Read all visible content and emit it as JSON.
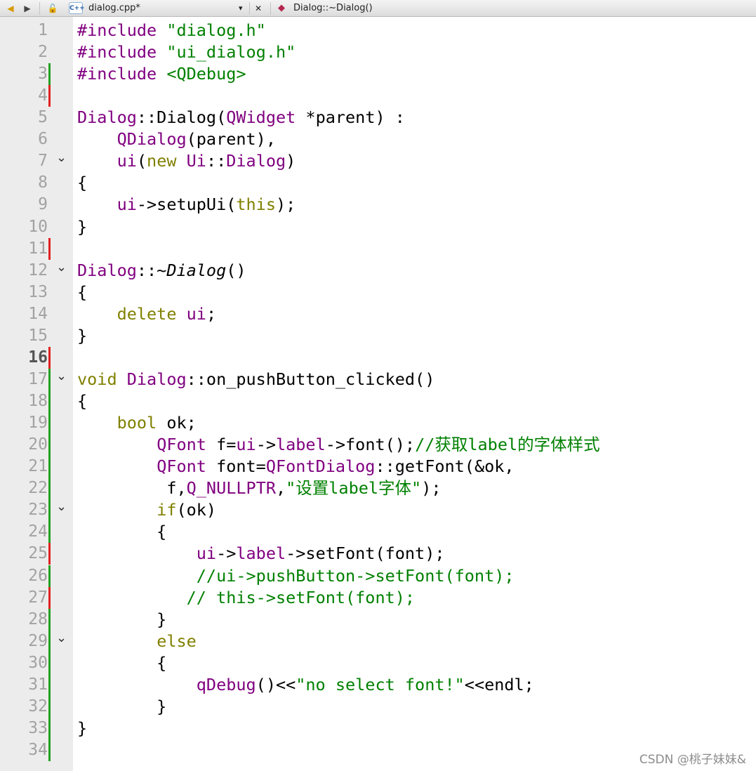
{
  "toolbar": {
    "back_icon": "back-arrow-icon",
    "forward_icon": "forward-arrow-icon",
    "lock_icon": "lock-icon",
    "file_icon": "cpp-file-icon",
    "file_badge": "C++",
    "file_name": "dialog.cpp*",
    "dropdown_icon": "▾",
    "close_icon": "✕",
    "symbol_icon": "symbol-icon",
    "current_symbol": "Dialog::~Dialog()"
  },
  "editor": {
    "current_line": 16,
    "lines": [
      {
        "n": "1",
        "mark": "",
        "fold": false,
        "seg": [
          {
            "t": "#include ",
            "c": "ty"
          },
          {
            "t": "\"dialog.h\"",
            "c": "str"
          }
        ]
      },
      {
        "n": "2",
        "mark": "",
        "fold": false,
        "seg": [
          {
            "t": "#include ",
            "c": "ty"
          },
          {
            "t": "\"ui_dialog.h\"",
            "c": "str"
          }
        ]
      },
      {
        "n": "3",
        "mark": "green",
        "fold": false,
        "seg": [
          {
            "t": "#include ",
            "c": "ty"
          },
          {
            "t": "<QDebug>",
            "c": "str"
          }
        ]
      },
      {
        "n": "4",
        "mark": "red",
        "fold": false,
        "seg": []
      },
      {
        "n": "5",
        "mark": "",
        "fold": false,
        "seg": [
          {
            "t": "Dialog",
            "c": "ty"
          },
          {
            "t": "::Dialog(",
            "c": ""
          },
          {
            "t": "QWidget",
            "c": "ty"
          },
          {
            "t": " *parent) :",
            "c": ""
          }
        ]
      },
      {
        "n": "6",
        "mark": "",
        "fold": false,
        "seg": [
          {
            "t": "    ",
            "c": ""
          },
          {
            "t": "QDialog",
            "c": "ty"
          },
          {
            "t": "(parent),",
            "c": ""
          }
        ]
      },
      {
        "n": "7",
        "mark": "",
        "fold": true,
        "seg": [
          {
            "t": "    ",
            "c": ""
          },
          {
            "t": "ui",
            "c": "ty"
          },
          {
            "t": "(",
            "c": ""
          },
          {
            "t": "new",
            "c": "kw"
          },
          {
            "t": " ",
            "c": ""
          },
          {
            "t": "Ui",
            "c": "ty"
          },
          {
            "t": "::",
            "c": ""
          },
          {
            "t": "Dialog",
            "c": "ty"
          },
          {
            "t": ")",
            "c": ""
          }
        ]
      },
      {
        "n": "8",
        "mark": "",
        "fold": false,
        "seg": [
          {
            "t": "{",
            "c": ""
          }
        ]
      },
      {
        "n": "9",
        "mark": "",
        "fold": false,
        "seg": [
          {
            "t": "    ",
            "c": ""
          },
          {
            "t": "ui",
            "c": "ty"
          },
          {
            "t": "->setupUi(",
            "c": ""
          },
          {
            "t": "this",
            "c": "kw"
          },
          {
            "t": ");",
            "c": ""
          }
        ]
      },
      {
        "n": "10",
        "mark": "",
        "fold": false,
        "seg": [
          {
            "t": "}",
            "c": ""
          }
        ]
      },
      {
        "n": "11",
        "mark": "red",
        "fold": false,
        "seg": []
      },
      {
        "n": "12",
        "mark": "",
        "fold": true,
        "seg": [
          {
            "t": "Dialog",
            "c": "ty"
          },
          {
            "t": "::~",
            "c": ""
          },
          {
            "t": "Dialog",
            "c": "it"
          },
          {
            "t": "()",
            "c": ""
          }
        ]
      },
      {
        "n": "13",
        "mark": "",
        "fold": false,
        "seg": [
          {
            "t": "{",
            "c": ""
          }
        ]
      },
      {
        "n": "14",
        "mark": "",
        "fold": false,
        "seg": [
          {
            "t": "    ",
            "c": ""
          },
          {
            "t": "delete",
            "c": "kw"
          },
          {
            "t": " ",
            "c": ""
          },
          {
            "t": "ui",
            "c": "ty"
          },
          {
            "t": ";",
            "c": ""
          }
        ]
      },
      {
        "n": "15",
        "mark": "",
        "fold": false,
        "seg": [
          {
            "t": "}",
            "c": ""
          }
        ]
      },
      {
        "n": "16",
        "mark": "red",
        "fold": false,
        "seg": []
      },
      {
        "n": "17",
        "mark": "green",
        "fold": true,
        "seg": [
          {
            "t": "void",
            "c": "kw"
          },
          {
            "t": " ",
            "c": ""
          },
          {
            "t": "Dialog",
            "c": "ty"
          },
          {
            "t": "::on_pushButton_clicked()",
            "c": ""
          }
        ]
      },
      {
        "n": "18",
        "mark": "green",
        "fold": false,
        "seg": [
          {
            "t": "{",
            "c": ""
          }
        ]
      },
      {
        "n": "19",
        "mark": "green",
        "fold": false,
        "seg": [
          {
            "t": "    ",
            "c": ""
          },
          {
            "t": "bool",
            "c": "kw"
          },
          {
            "t": " ok;",
            "c": ""
          }
        ]
      },
      {
        "n": "20",
        "mark": "green",
        "fold": false,
        "seg": [
          {
            "t": "        ",
            "c": ""
          },
          {
            "t": "QFont",
            "c": "ty"
          },
          {
            "t": " f=",
            "c": ""
          },
          {
            "t": "ui",
            "c": "ty"
          },
          {
            "t": "->",
            "c": ""
          },
          {
            "t": "label",
            "c": "ty"
          },
          {
            "t": "->font();",
            "c": ""
          },
          {
            "t": "//获取label的字体样式",
            "c": "cmt"
          }
        ]
      },
      {
        "n": "21",
        "mark": "green",
        "fold": false,
        "seg": [
          {
            "t": "        ",
            "c": ""
          },
          {
            "t": "QFont",
            "c": "ty"
          },
          {
            "t": " font=",
            "c": ""
          },
          {
            "t": "QFontDialog",
            "c": "ty"
          },
          {
            "t": "::getFont(&ok,",
            "c": ""
          }
        ]
      },
      {
        "n": "22",
        "mark": "green",
        "fold": false,
        "seg": [
          {
            "t": "         f,",
            "c": ""
          },
          {
            "t": "Q_NULLPTR",
            "c": "ty"
          },
          {
            "t": ",",
            "c": ""
          },
          {
            "t": "\"设置label字体\"",
            "c": "str"
          },
          {
            "t": ");",
            "c": ""
          }
        ]
      },
      {
        "n": "23",
        "mark": "green",
        "fold": true,
        "seg": [
          {
            "t": "        ",
            "c": ""
          },
          {
            "t": "if",
            "c": "kw"
          },
          {
            "t": "(ok)",
            "c": ""
          }
        ]
      },
      {
        "n": "24",
        "mark": "green",
        "fold": false,
        "seg": [
          {
            "t": "        {",
            "c": ""
          }
        ]
      },
      {
        "n": "25",
        "mark": "red",
        "fold": false,
        "seg": [
          {
            "t": "            ",
            "c": ""
          },
          {
            "t": "ui",
            "c": "ty"
          },
          {
            "t": "->",
            "c": ""
          },
          {
            "t": "label",
            "c": "ty"
          },
          {
            "t": "->setFont(font);",
            "c": ""
          }
        ]
      },
      {
        "n": "26",
        "mark": "green",
        "fold": false,
        "seg": [
          {
            "t": "            ",
            "c": ""
          },
          {
            "t": "//ui->pushButton->setFont(font);",
            "c": "cmt"
          }
        ]
      },
      {
        "n": "27",
        "mark": "red",
        "fold": false,
        "seg": [
          {
            "t": "           ",
            "c": ""
          },
          {
            "t": "// this->setFont(font);",
            "c": "cmt"
          }
        ]
      },
      {
        "n": "28",
        "mark": "green",
        "fold": false,
        "seg": [
          {
            "t": "        }",
            "c": ""
          }
        ]
      },
      {
        "n": "29",
        "mark": "green",
        "fold": true,
        "seg": [
          {
            "t": "        ",
            "c": ""
          },
          {
            "t": "else",
            "c": "kw"
          }
        ]
      },
      {
        "n": "30",
        "mark": "green",
        "fold": false,
        "seg": [
          {
            "t": "        {",
            "c": ""
          }
        ]
      },
      {
        "n": "31",
        "mark": "green",
        "fold": false,
        "seg": [
          {
            "t": "            ",
            "c": ""
          },
          {
            "t": "qDebug",
            "c": "ty"
          },
          {
            "t": "()<<",
            "c": ""
          },
          {
            "t": "\"no select font!\"",
            "c": "str"
          },
          {
            "t": "<<endl;",
            "c": ""
          }
        ]
      },
      {
        "n": "32",
        "mark": "green",
        "fold": false,
        "seg": [
          {
            "t": "        }",
            "c": ""
          }
        ]
      },
      {
        "n": "33",
        "mark": "green",
        "fold": false,
        "seg": [
          {
            "t": "}",
            "c": ""
          }
        ]
      },
      {
        "n": "34",
        "mark": "green",
        "fold": false,
        "seg": []
      }
    ]
  },
  "colors": {
    "keyword": "#808000",
    "type": "#800080",
    "string": "#008000",
    "comment": "#008000",
    "marker_green": "#22a022",
    "marker_red": "#e02020",
    "gutter": "#ececec"
  },
  "watermark": "CSDN @桃子妹妹&"
}
